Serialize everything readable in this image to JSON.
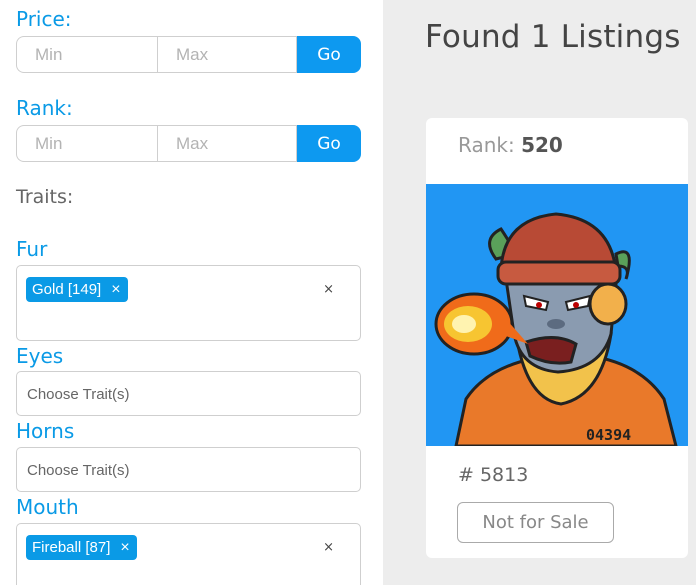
{
  "filters": {
    "price": {
      "label": "Price:",
      "min_placeholder": "Min",
      "max_placeholder": "Max",
      "go_label": "Go"
    },
    "rank": {
      "label": "Rank:",
      "min_placeholder": "Min",
      "max_placeholder": "Max",
      "go_label": "Go"
    },
    "traits_label": "Traits:",
    "traits": [
      {
        "label": "Fur",
        "chips": [
          "Gold [149]"
        ],
        "placeholder": ""
      },
      {
        "label": "Eyes",
        "chips": [],
        "placeholder": "Choose Trait(s)"
      },
      {
        "label": "Horns",
        "chips": [],
        "placeholder": "Choose Trait(s)"
      },
      {
        "label": "Mouth",
        "chips": [
          "Fireball [87]"
        ],
        "placeholder": ""
      }
    ],
    "chip_remove_glyph": "×",
    "clear_glyph": "×"
  },
  "results": {
    "heading": "Found 1 Listings",
    "card": {
      "rank_label": "Rank:",
      "rank_value": "520",
      "image_text": "04394",
      "token_id": "# 5813",
      "sale_button": "Not for Sale"
    }
  },
  "colors": {
    "accent": "#0a9ae6",
    "go_button": "#0d99f0",
    "image_bg": "#2196f3"
  }
}
